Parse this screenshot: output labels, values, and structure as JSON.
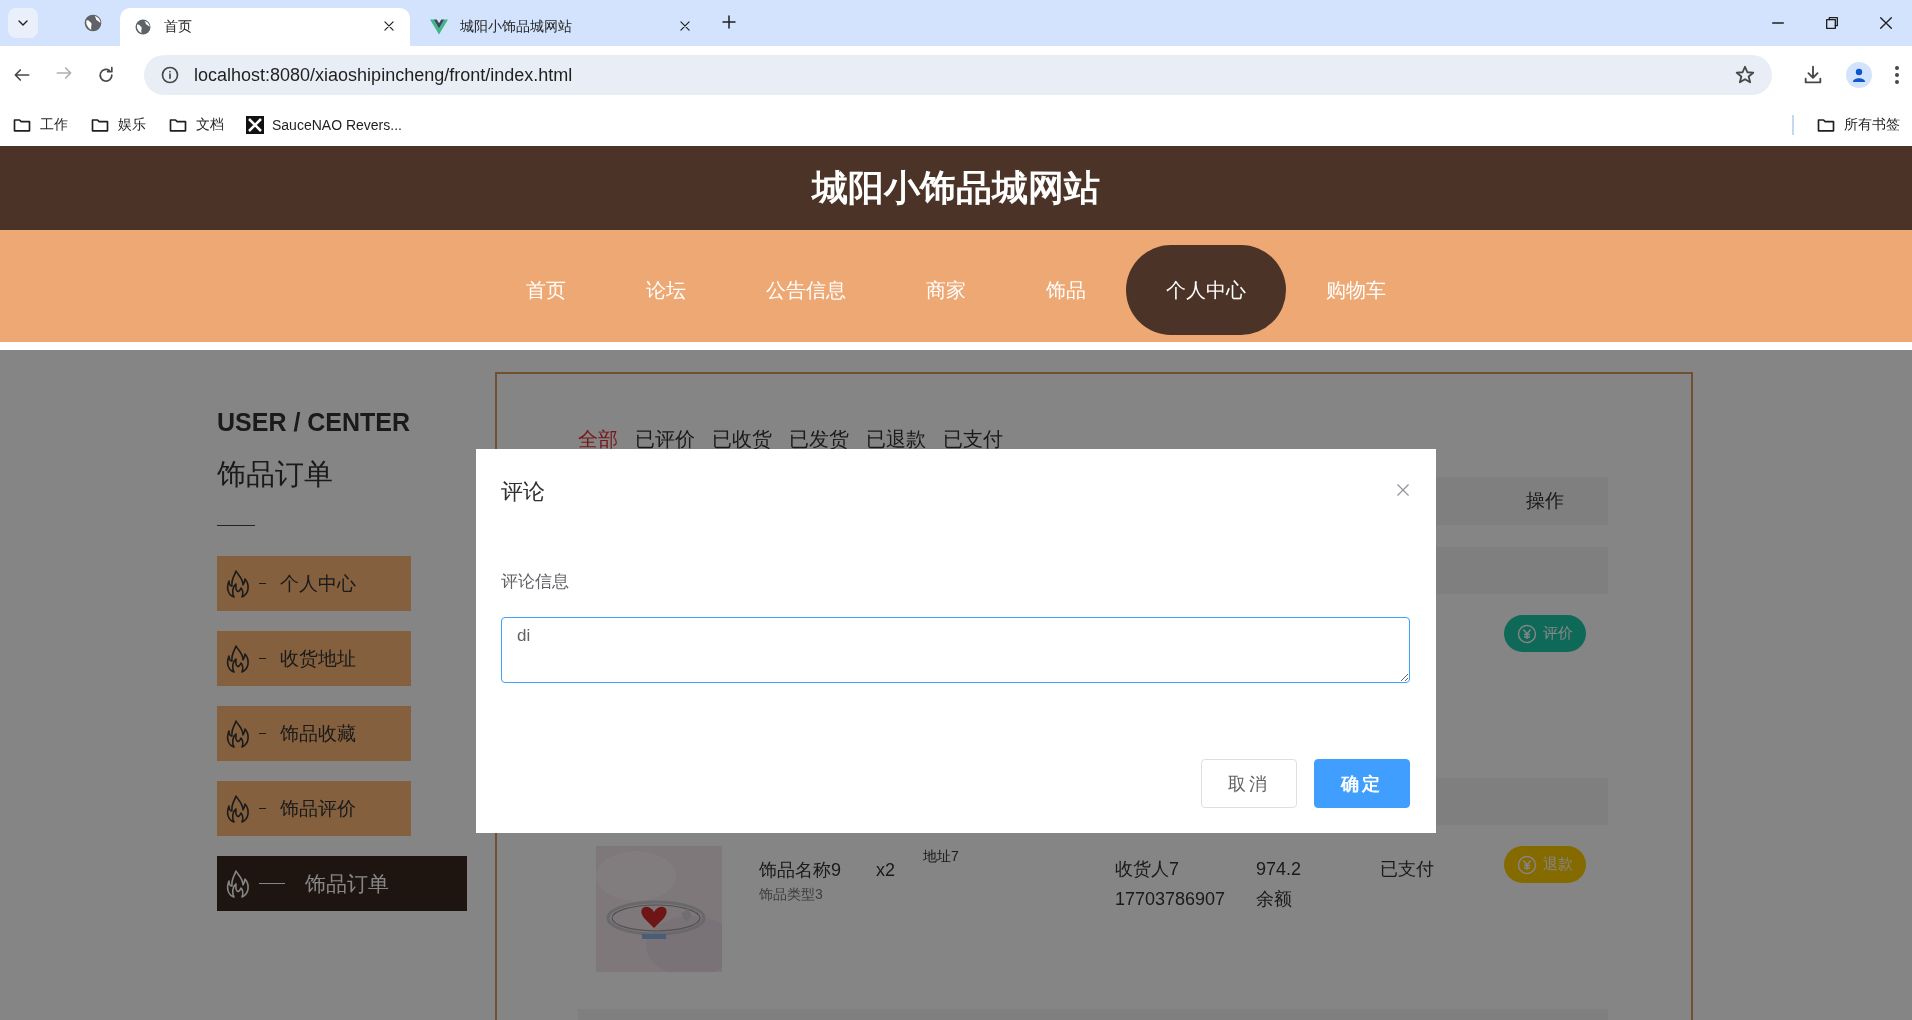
{
  "browser": {
    "tabs": [
      {
        "title": "首页",
        "selected": true,
        "kind": "globe"
      },
      {
        "title": "城阳小饰品城网站",
        "selected": false,
        "kind": "vue"
      }
    ],
    "url": "localhost:8080/xiaoshipincheng/front/index.html",
    "bookmarks": [
      {
        "label": "工作",
        "kind": "folder"
      },
      {
        "label": "娱乐",
        "kind": "folder"
      },
      {
        "label": "文档",
        "kind": "folder"
      },
      {
        "label": "SauceNAO Revers...",
        "kind": "site"
      }
    ],
    "all_bookmarks": "所有书签"
  },
  "site": {
    "title": "城阳小饰品城网站",
    "nav": [
      {
        "label": "首页",
        "selected": false
      },
      {
        "label": "论坛",
        "selected": false
      },
      {
        "label": "公告信息",
        "selected": false
      },
      {
        "label": "商家",
        "selected": false
      },
      {
        "label": "饰品",
        "selected": false
      },
      {
        "label": "个人中心",
        "selected": true
      },
      {
        "label": "购物车",
        "selected": false
      }
    ]
  },
  "sidebar": {
    "heading": "USER / CENTER",
    "section": "饰品订单",
    "items": [
      {
        "label": "个人中心",
        "selected": false
      },
      {
        "label": "收货地址",
        "selected": false
      },
      {
        "label": "饰品收藏",
        "selected": false
      },
      {
        "label": "饰品评价",
        "selected": false
      },
      {
        "label": "饰品订单",
        "selected": true
      }
    ]
  },
  "orders": {
    "filters": [
      {
        "label": "全部",
        "selected": true
      },
      {
        "label": "已评价",
        "selected": false
      },
      {
        "label": "已收货",
        "selected": false
      },
      {
        "label": "已发货",
        "selected": false
      },
      {
        "label": "已退款",
        "selected": false
      },
      {
        "label": "已支付",
        "selected": false
      }
    ],
    "header": {
      "action": "操作"
    },
    "rows": [
      {
        "action": {
          "label": "评价",
          "kind": "review"
        }
      },
      {
        "name": "饰品名称9",
        "type": "饰品类型3",
        "quantity": "x2",
        "address": "地址7",
        "receiver": "收货人7",
        "phone": "17703786907",
        "price": "974.2",
        "payment": "余额",
        "status": "已支付",
        "action": {
          "label": "退款",
          "kind": "refund"
        }
      }
    ]
  },
  "dialog": {
    "title": "评论",
    "field_label": "评论信息",
    "value": "di",
    "buttons": [
      {
        "label": "取消",
        "kind": "secondary"
      },
      {
        "label": "确定",
        "kind": "primary"
      }
    ]
  }
}
